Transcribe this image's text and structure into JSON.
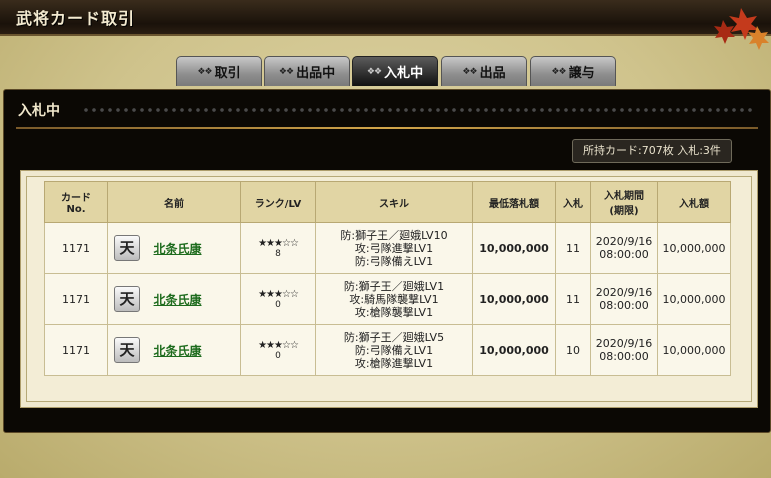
{
  "header": {
    "title": "武将カード取引"
  },
  "tabs": [
    {
      "label": "取引",
      "active": false
    },
    {
      "label": "出品中",
      "active": false
    },
    {
      "label": "入札中",
      "active": true
    },
    {
      "label": "出品",
      "active": false
    },
    {
      "label": "譲与",
      "active": false
    }
  ],
  "panel": {
    "heading": "入札中",
    "status": "所持カード:707枚  入札:3件"
  },
  "table": {
    "headers": {
      "card_no_1": "カード",
      "card_no_2": "No.",
      "name": "名前",
      "rank": "ランク/LV",
      "skill": "スキル",
      "min_bid": "最低落札額",
      "bids": "入札",
      "period_1": "入札期間",
      "period_2": "(期限)",
      "bid_amount": "入札額"
    },
    "rows": [
      {
        "card_no": "1171",
        "icon": "天",
        "name": "北条氏康",
        "stars": "★★★☆☆",
        "lv": "8",
        "skill1": "防:獅子王／廻娥LV10",
        "skill2": "攻:弓隊進撃LV1",
        "skill3": "防:弓隊備えLV1",
        "min_bid": "10,000,000",
        "bids": "11",
        "date": "2020/9/16",
        "time": "08:00:00",
        "bid_amount": "10,000,000"
      },
      {
        "card_no": "1171",
        "icon": "天",
        "name": "北条氏康",
        "stars": "★★★☆☆",
        "lv": "0",
        "skill1": "防:獅子王／廻娥LV1",
        "skill2": "攻:騎馬隊襲撃LV1",
        "skill3": "攻:槍隊襲撃LV1",
        "min_bid": "10,000,000",
        "bids": "11",
        "date": "2020/9/16",
        "time": "08:00:00",
        "bid_amount": "10,000,000"
      },
      {
        "card_no": "1171",
        "icon": "天",
        "name": "北条氏康",
        "stars": "★★★☆☆",
        "lv": "0",
        "skill1": "防:獅子王／廻娥LV5",
        "skill2": "防:弓隊備えLV1",
        "skill3": "攻:槍隊進撃LV1",
        "min_bid": "10,000,000",
        "bids": "10",
        "date": "2020/9/16",
        "time": "08:00:00",
        "bid_amount": "10,000,000"
      }
    ]
  }
}
